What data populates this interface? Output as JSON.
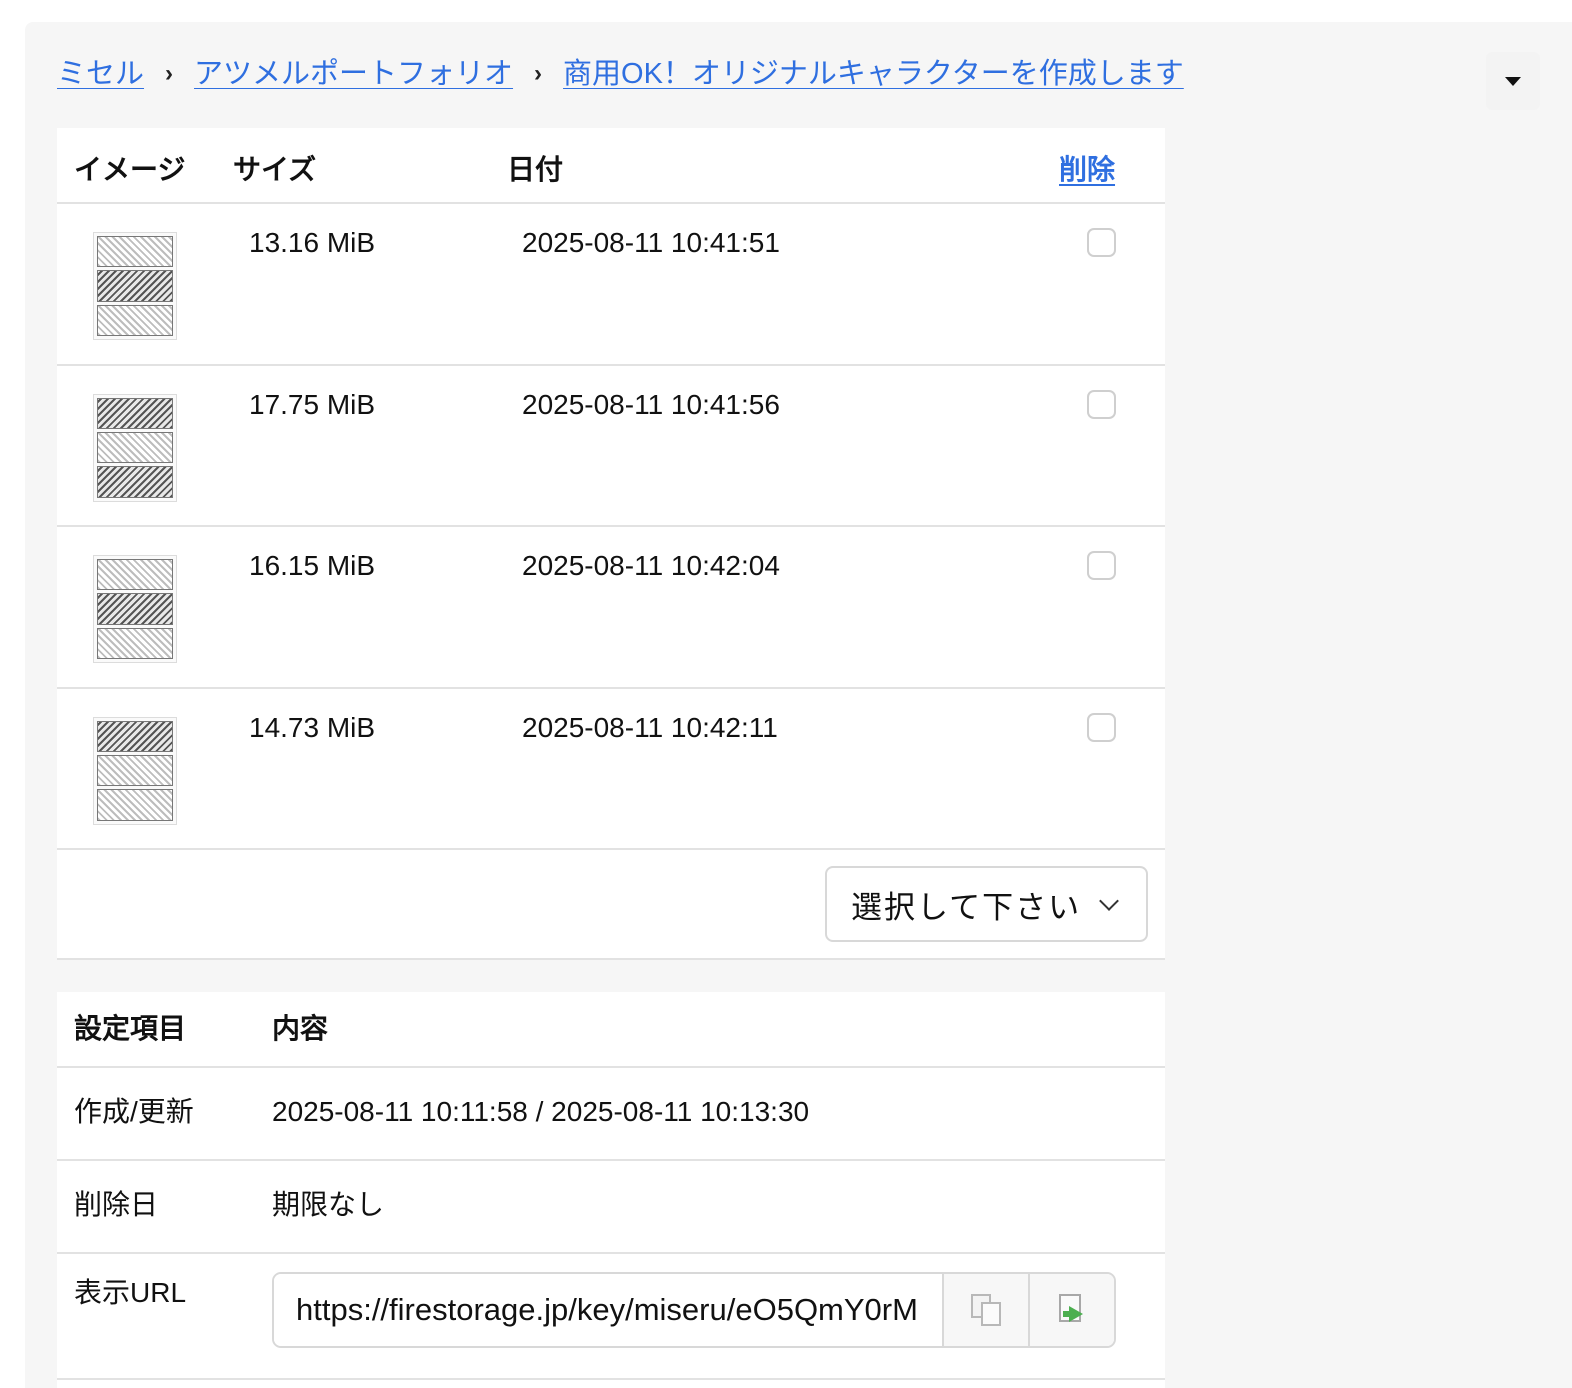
{
  "breadcrumb": {
    "items": [
      {
        "label": "ミセル"
      },
      {
        "label": "アツメルポートフォリオ"
      },
      {
        "label": "商用OK！オリジナルキャラクターを作成します"
      }
    ],
    "separator": "›"
  },
  "files_table": {
    "headers": {
      "image": "イメージ",
      "size": "サイズ",
      "date": "日付",
      "delete": "削除"
    },
    "rows": [
      {
        "size": "13.16 MiB",
        "date": "2025-08-11 10:41:51",
        "checked": false
      },
      {
        "size": "17.75 MiB",
        "date": "2025-08-11 10:41:56",
        "checked": false
      },
      {
        "size": "16.15 MiB",
        "date": "2025-08-11 10:42:04",
        "checked": false
      },
      {
        "size": "14.73 MiB",
        "date": "2025-08-11 10:42:11",
        "checked": false
      }
    ],
    "action_select": {
      "value": "選択して下さい"
    }
  },
  "settings": {
    "headers": {
      "key": "設定項目",
      "value": "内容"
    },
    "created_updated": {
      "label": "作成/更新",
      "value": "2025-08-11 10:11:58 / 2025-08-11 10:13:30"
    },
    "delete_date": {
      "label": "削除日",
      "value": "期限なし"
    },
    "display_url": {
      "label": "表示URL",
      "value": "https://firestorage.jp/key/miseru/eO5QmY0rM"
    }
  },
  "icons": {
    "dropdown": "caret-down-icon",
    "copy": "copy-icon",
    "open": "open-link-icon"
  },
  "colors": {
    "link": "#2f6fe0",
    "background": "#f6f6f6",
    "card": "#ffffff"
  }
}
